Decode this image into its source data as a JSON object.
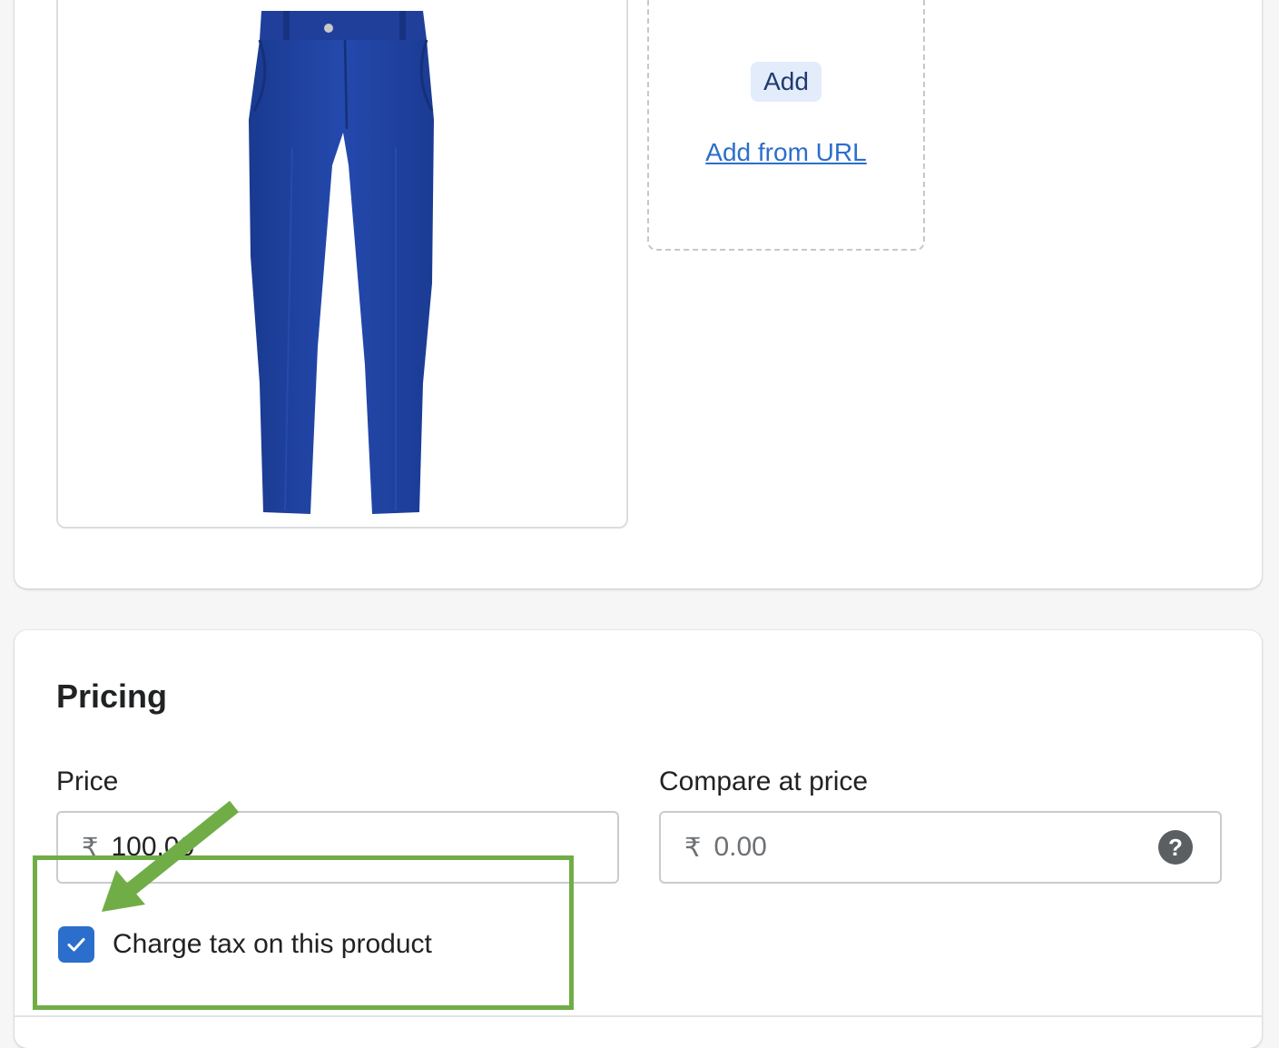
{
  "media": {
    "add_button_label": "Add",
    "add_from_url_label": "Add from URL"
  },
  "pricing": {
    "title": "Pricing",
    "price_label": "Price",
    "price_currency": "₹",
    "price_value": "100.00",
    "compare_label": "Compare at price",
    "compare_currency": "₹",
    "compare_placeholder": "0.00",
    "help_icon": "?",
    "charge_tax_label": "Charge tax on this product",
    "charge_tax_checked": true
  },
  "icons": {
    "product_image": "blue-trousers-image",
    "help": "question-circle-icon",
    "checkmark": "checkmark-icon",
    "annotation_arrow": "green-arrow-icon"
  },
  "colors": {
    "accent": "#2c6ecb",
    "annotation": "#70ad47",
    "trousers": "#2145a4"
  }
}
